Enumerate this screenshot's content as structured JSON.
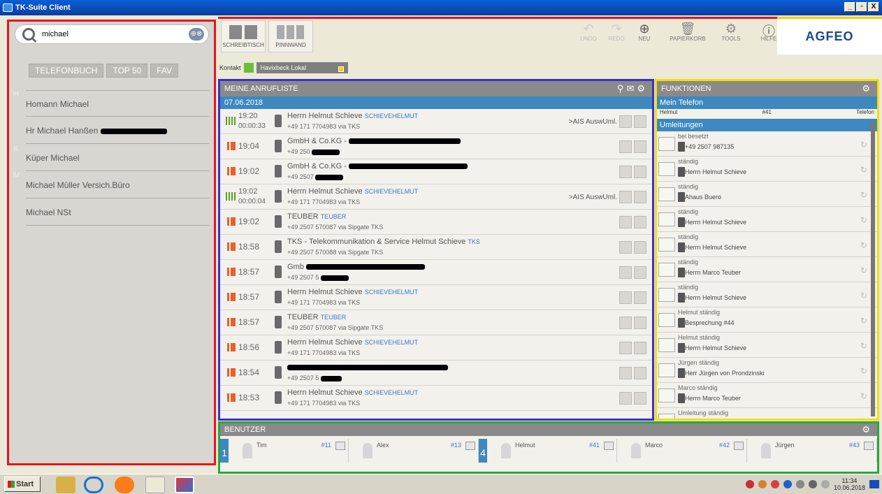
{
  "window": {
    "title": "TK-Suite Client",
    "controls": [
      "_",
      "▫",
      "X"
    ]
  },
  "search": {
    "value": "michael",
    "clear": "⊕⊗"
  },
  "left": {
    "tabs": [
      "TELEFONBUCH",
      "TOP 50",
      "FAV"
    ],
    "letters": [
      "H",
      "K",
      "M"
    ],
    "entries": [
      "Homann Michael",
      "Hr Michael Hanßen",
      "Küper Michael",
      "Michael Müller Versich.Büro",
      "Michael NSt"
    ]
  },
  "toolbar": {
    "views": [
      "SCHREIBTISCH",
      "PINNWAND"
    ],
    "actions": [
      "UNDO",
      "REDO",
      "NEU",
      "PAPIERKORB",
      "TOOLS",
      "HILFE"
    ],
    "logo": "AGFEO"
  },
  "context": {
    "label": "Kontakt",
    "source": "Havixbeck Lokal"
  },
  "calls": {
    "title": "MEINE ANRUFLISTE",
    "date": "07.06.2018",
    "rows": [
      {
        "time": "19:20",
        "dur": "00:00:33",
        "name": "Herrn Helmut Schieve",
        "tag": "SCHIEVEHELMUT",
        "num": "+49 171 7704983 via TKS",
        "extra": ">AIS AuswUml."
      },
      {
        "time": "19:04",
        "dur": "",
        "name": "GmbH & Co.KG -",
        "tag": "",
        "num": "+49 250",
        "extra": ""
      },
      {
        "time": "19:02",
        "dur": "",
        "name": "GmbH & Co.KG -",
        "tag": "",
        "num": "+49 2507",
        "extra": ""
      },
      {
        "time": "19:02",
        "dur": "00:00:04",
        "name": "Herrn Helmut Schieve",
        "tag": "SCHIEVEHELMUT",
        "num": "+49 171 7704983 via TKS",
        "extra": ">AIS AuswUml."
      },
      {
        "time": "19:02",
        "dur": "",
        "name": "TEUBER",
        "tag": "TEUBER",
        "num": "+49 2507 570087 via Sipgate TKS",
        "extra": ""
      },
      {
        "time": "18:58",
        "dur": "",
        "name": "TKS - Telekommunikation & Service Helmut Schieve",
        "tag": "TKS",
        "num": "+49 2507 570088 via Sipgate TKS",
        "extra": ""
      },
      {
        "time": "18:57",
        "dur": "",
        "name": "Gmb",
        "tag": "",
        "num": "+49 2507 5",
        "extra": ""
      },
      {
        "time": "18:57",
        "dur": "",
        "name": "Herrn Helmut Schieve",
        "tag": "SCHIEVEHELMUT",
        "num": "+49 171 7704983 via TKS",
        "extra": ""
      },
      {
        "time": "18:57",
        "dur": "",
        "name": "TEUBER",
        "tag": "TEUBER",
        "num": "+49 2507 570087 via Sipgate TKS",
        "extra": ""
      },
      {
        "time": "18:56",
        "dur": "",
        "name": "Herrn Helmut Schieve",
        "tag": "SCHIEVEHELMUT",
        "num": "+49 171 7704983 via TKS",
        "extra": ""
      },
      {
        "time": "18:54",
        "dur": "",
        "name": "",
        "tag": "",
        "num": "+49 2507 5",
        "extra": ""
      },
      {
        "time": "18:53",
        "dur": "",
        "name": "Herrn Helmut Schieve",
        "tag": "SCHIEVEHELMUT",
        "num": "+49 171 7704983 via TKS",
        "extra": ""
      }
    ]
  },
  "funcs": {
    "title": "FUNKTIONEN",
    "section1": "Mein Telefon",
    "phone": {
      "user": "Helmut",
      "ext": "#41",
      "type": "Telefon"
    },
    "section2": "Umleitungen",
    "rows": [
      {
        "label": "bei besetzt",
        "target": "+49 2507 987135"
      },
      {
        "label": "ständig",
        "target": "Herrn Helmut Schieve"
      },
      {
        "label": "ständig",
        "target": "Ahaus Buero"
      },
      {
        "label": "ständig",
        "target": "Herrn Helmut Schieve"
      },
      {
        "label": "ständig",
        "target": "Herrn Helmut Schieve"
      },
      {
        "label": "ständig",
        "target": "Herrn Marco Teuber"
      },
      {
        "label": "ständig",
        "target": "Herrn Helmut Schieve"
      },
      {
        "label": "Helmut ständig",
        "target": "Besprechung #44"
      },
      {
        "label": "Helmut ständig",
        "target": "Herrn Helmut Schieve"
      },
      {
        "label": "Jürgen ständig",
        "target": "Herr Jürgen von Prondzinski"
      },
      {
        "label": "Marco ständig",
        "target": "Herrn Marco Teuber"
      },
      {
        "label": "Umleitung ständig",
        "target": ""
      }
    ]
  },
  "users": {
    "title": "BENUTZER",
    "groups": [
      {
        "num": "1",
        "users": [
          {
            "name": "Tim",
            "ext": "#11"
          },
          {
            "name": "Alex",
            "ext": "#13"
          }
        ]
      },
      {
        "num": "4",
        "users": [
          {
            "name": "Helmut",
            "ext": "#41"
          },
          {
            "name": "Marco",
            "ext": "#42"
          },
          {
            "name": "Jürgen",
            "ext": "#43"
          }
        ]
      }
    ]
  },
  "taskbar": {
    "start": "Start",
    "time": "11:34",
    "date": "10.06.2018"
  }
}
